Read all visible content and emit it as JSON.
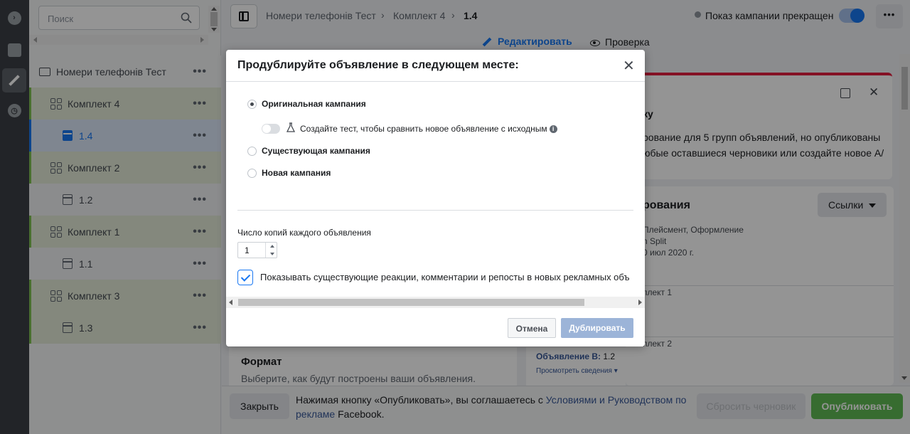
{
  "tree": {
    "search_placeholder": "Поиск",
    "rows": [
      {
        "label": "Номери телефонів Тест",
        "type": "campaign"
      },
      {
        "label": "Комплект 4",
        "type": "adset"
      },
      {
        "label": "1.4",
        "type": "ad",
        "selected": true
      },
      {
        "label": "Комплект 2",
        "type": "adset"
      },
      {
        "label": "1.2",
        "type": "ad"
      },
      {
        "label": "Комплект 1",
        "type": "adset"
      },
      {
        "label": "1.1",
        "type": "ad"
      },
      {
        "label": "Комплект 3",
        "type": "adset"
      },
      {
        "label": "1.3",
        "type": "ad"
      }
    ],
    "more": "•••"
  },
  "header": {
    "breadcrumb": [
      "Номери телефонів Тест",
      "Комплект 4",
      "1.4"
    ],
    "status": "Показ кампании прекращен",
    "more": "•••",
    "mode_edit": "Редактировать",
    "mode_review": "Проверка"
  },
  "background": {
    "warn_title": "ку",
    "warn_text": "рование для 5 групп объявлений, но опубликованы\nюбые оставшиеся черновики или создайте новое A/",
    "info_title": "рования",
    "links_btn": "Ссылки",
    "info_lines": [
      "Плейсмент, Оформление",
      "n Split",
      "0 июл 2020 г."
    ],
    "list_1": "плект 1",
    "list_2": "плект 2",
    "format_title": "Формат",
    "format_sub": "Выберите, как будут построены ваши объявления.",
    "ad_b_label": "Объявление B:",
    "ad_b_value": "1.2",
    "view_details": "Просмотреть сведения"
  },
  "footer": {
    "close": "Закрыть",
    "text_1": "Нажимая кнопку «Опубликовать», вы соглашаетесь с ",
    "link": "Условиями и Руководством по рекламе",
    "text_2": " Facebook.",
    "reset": "Сбросить черновик",
    "publish": "Опубликовать"
  },
  "modal": {
    "title": "Продублируйте объявление в следующем месте:",
    "close": "✕",
    "options": [
      {
        "label": "Оригинальная кампания",
        "selected": true
      },
      {
        "label": "Существующая кампания",
        "selected": false
      },
      {
        "label": "Новая кампания",
        "selected": false
      }
    ],
    "ab_test_label": "Создайте тест, чтобы сравнить новое объявление с исходным",
    "copies_label": "Число копий каждого объявления",
    "copies_value": "1",
    "checkbox_label": "Показывать существующие реакции, комментарии и репосты в новых рекламных объ",
    "checkbox_checked": true,
    "cancel": "Отмена",
    "duplicate": "Дублировать"
  },
  "colors": {
    "accent": "#1877f2",
    "publish": "#5fba53",
    "adset": "#e3ebd8",
    "warning": "#e41e3f"
  }
}
